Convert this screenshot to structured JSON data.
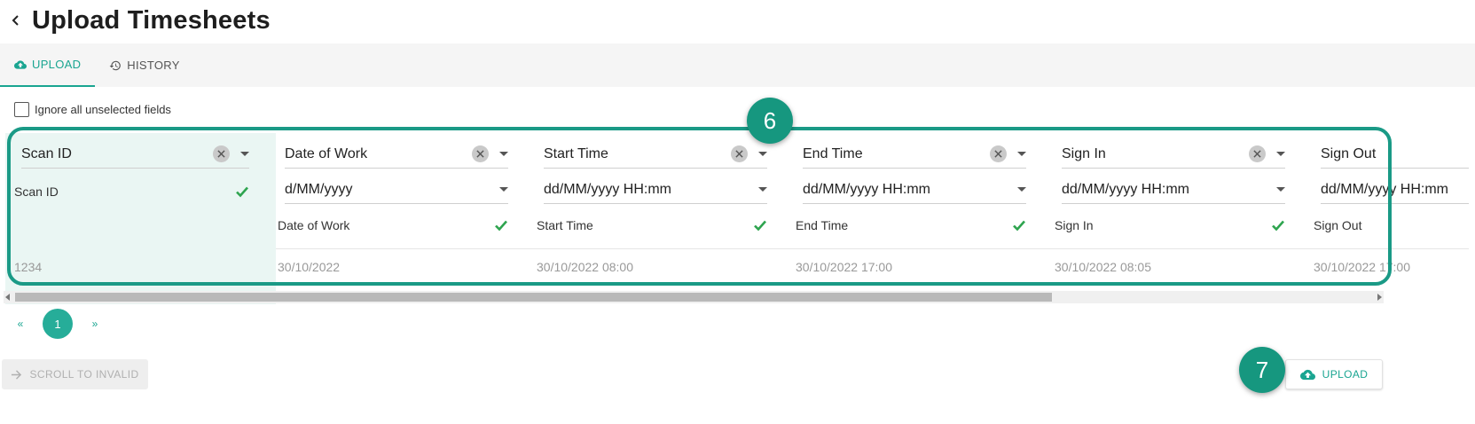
{
  "header": {
    "back_icon": "chevron-left-icon",
    "title": "Upload Timesheets"
  },
  "tabs": [
    {
      "label": "UPLOAD",
      "icon": "cloud-upload-icon",
      "active": true
    },
    {
      "label": "HISTORY",
      "icon": "history-icon",
      "active": false
    }
  ],
  "options": {
    "ignore_label": "Ignore all unselected fields",
    "ignore_checked": false
  },
  "columns": [
    {
      "header": "Scan ID",
      "format": "",
      "mapped": "Scan ID",
      "value": "1234"
    },
    {
      "header": "Date of Work",
      "format": "d/MM/yyyy",
      "mapped": "Date of Work",
      "value": "30/10/2022"
    },
    {
      "header": "Start Time",
      "format": "dd/MM/yyyy HH:mm",
      "mapped": "Start Time",
      "value": "30/10/2022 08:00"
    },
    {
      "header": "End Time",
      "format": "dd/MM/yyyy HH:mm",
      "mapped": "End Time",
      "value": "30/10/2022 17:00"
    },
    {
      "header": "Sign In",
      "format": "dd/MM/yyyy HH:mm",
      "mapped": "Sign In",
      "value": "30/10/2022 08:05"
    },
    {
      "header": "Sign Out",
      "format": "dd/MM/yyyy HH:mm",
      "mapped": "Sign Out",
      "value": "30/10/2022 17:00"
    }
  ],
  "pagination": {
    "prev": "«",
    "current": "1",
    "next": "»"
  },
  "actions": {
    "scroll_invalid": "SCROLL TO INVALID",
    "upload": "UPLOAD"
  },
  "annotations": {
    "badge_grid": "6",
    "badge_upload": "7"
  },
  "colors": {
    "accent": "#1aa591",
    "badge": "#16977f",
    "first_column_bg": "#eaf6f3",
    "check": "#2ea44f"
  }
}
